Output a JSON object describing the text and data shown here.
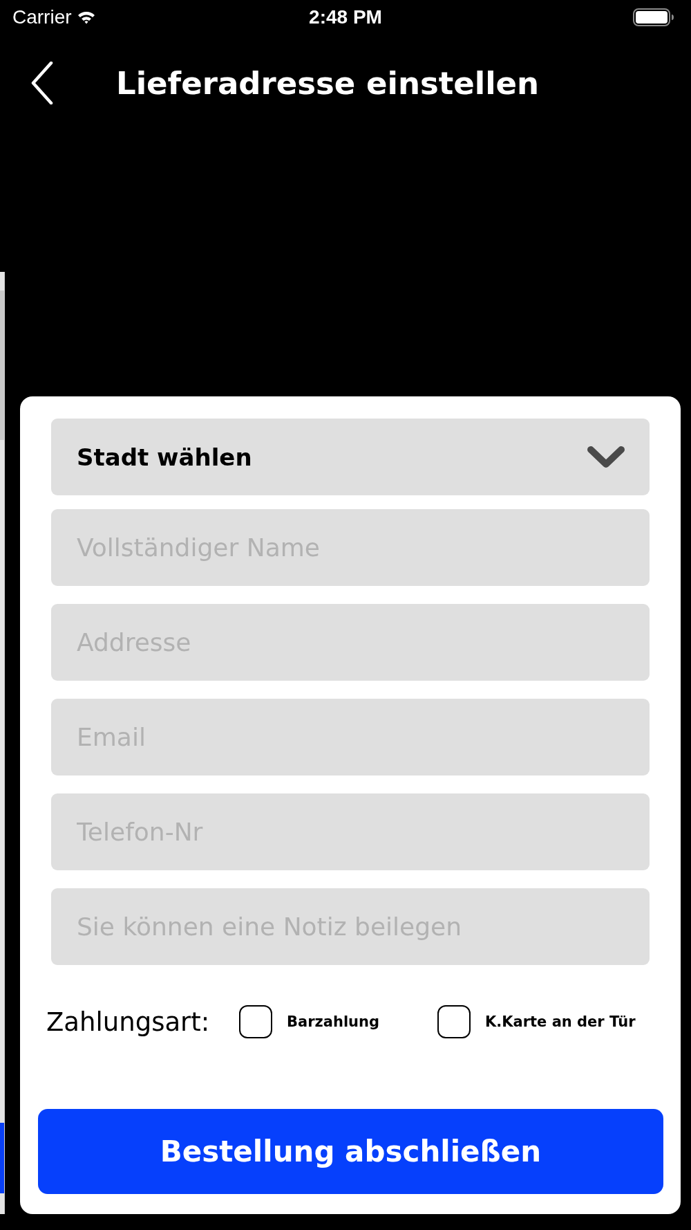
{
  "status_bar": {
    "carrier": "Carrier",
    "time": "2:48 PM"
  },
  "header": {
    "title": "Lieferadresse einstellen"
  },
  "form": {
    "city_select": {
      "value": "Stadt wählen"
    },
    "fields": [
      {
        "placeholder": "Vollständiger Name"
      },
      {
        "placeholder": "Addresse"
      },
      {
        "placeholder": "Email"
      },
      {
        "placeholder": "Telefon-Nr"
      },
      {
        "placeholder": "Sie können eine Notiz beilegen"
      }
    ],
    "payment": {
      "label": "Zahlungsart:",
      "options": [
        {
          "label": "Barzahlung",
          "checked": false
        },
        {
          "label": "K.Karte an der Tür",
          "checked": false
        }
      ]
    },
    "submit_button": {
      "label": "Bestellung abschließen"
    }
  }
}
